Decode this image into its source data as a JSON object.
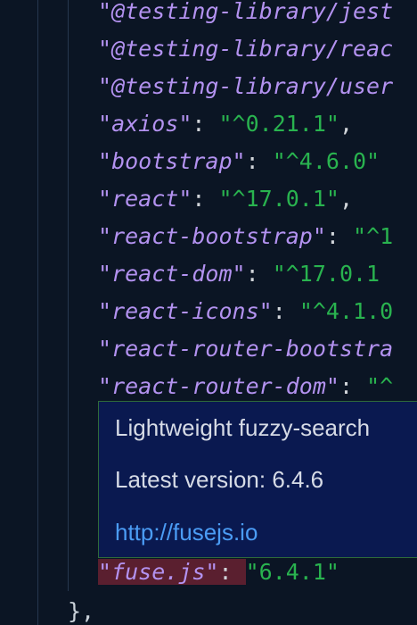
{
  "editor": {
    "deps": [
      {
        "key": "@testing-library/jest",
        "value": "",
        "sep": ""
      },
      {
        "key": "@testing-library/reac",
        "value": "",
        "sep": ""
      },
      {
        "key": "@testing-library/user",
        "value": "",
        "sep": ""
      },
      {
        "key": "axios",
        "value": "\"^0.21.1\"",
        "sep": ": ",
        "tail": ","
      },
      {
        "key": "bootstrap",
        "value": "\"^4.6.0\"",
        "sep": ": ",
        "tail": ""
      },
      {
        "key": "react",
        "value": "\"^17.0.1\"",
        "sep": ": ",
        "tail": ","
      },
      {
        "key": "react-bootstrap",
        "value": "\"^1",
        "sep": ": ",
        "tail": ""
      },
      {
        "key": "react-dom",
        "value": "\"^17.0.1",
        "sep": ": ",
        "tail": ""
      },
      {
        "key": "react-icons",
        "value": "\"^4.1.0",
        "sep": ": ",
        "tail": ""
      },
      {
        "key": "react-router-bootstra",
        "value": "",
        "sep": "",
        "tail": ""
      },
      {
        "key": "react-router-dom",
        "value": "\"^",
        "sep": ": ",
        "tail": ""
      }
    ],
    "error_line": {
      "key": "fuse.js",
      "sep": ": ",
      "value": "\"6.4.1\""
    },
    "closing": "},"
  },
  "hover": {
    "description": "Lightweight fuzzy-search",
    "latest_version": "Latest version: 6.4.6",
    "link": "http://fusejs.io"
  },
  "colors": {
    "background": "#0b1524",
    "key": "#b392f0",
    "string": "#29b34f",
    "hover_bg": "#0a1950",
    "link": "#4b9cf5",
    "error_bg": "#7a0f1a"
  }
}
